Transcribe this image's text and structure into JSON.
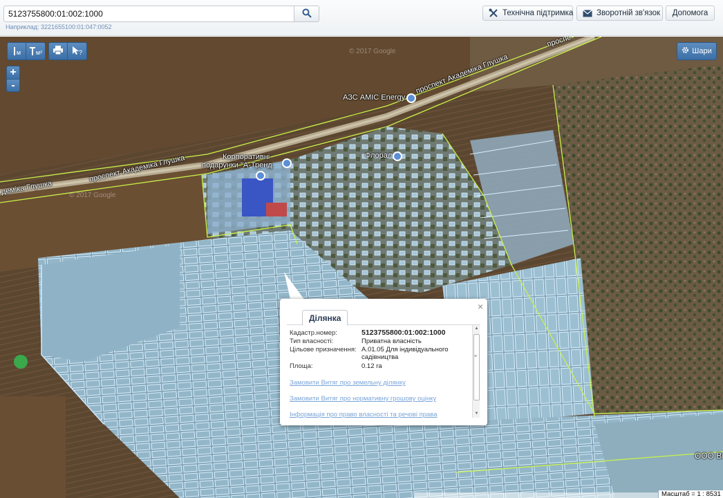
{
  "search": {
    "value": "5123755800:01:002:1000",
    "hint": "Наприклад: 3221655100:01:047:0052",
    "button_icon": "search-icon"
  },
  "header_buttons": [
    {
      "label": "Технічна підтримка",
      "icon": "tools-icon"
    },
    {
      "label": "Зворотній зв'язок",
      "icon": "envelope-icon"
    },
    {
      "label": "Допомога"
    }
  ],
  "map_tools": {
    "measure_length_label": "м",
    "measure_area_label": "м²",
    "zoom_in": "+",
    "zoom_out": "-",
    "layers_label": "Шари"
  },
  "map_labels": {
    "road_1": "проспект Академіка Глушка",
    "road_2": "проспект Академіка Глушка",
    "road_3": "проспект Академіка Глушка",
    "road_left": "деміка Глушка",
    "road_top_right": "проспе",
    "poi_aes": "АЗС AMIC Energy",
    "poi_flora": "Флорал",
    "poi_gifts_1": "Корпоративні",
    "poi_gifts_2": "подарунки \"А-Тренд",
    "poi_ooo": "ООО Ви",
    "watermark_1": "© 2017 Google",
    "watermark_2": "© 2017 Google"
  },
  "popup": {
    "close": "×",
    "tab": "Ділянка",
    "fields": [
      {
        "label": "Кадастр.номер:",
        "value": "5123755800:01:002:1000"
      },
      {
        "label": "Тип власності:",
        "value": "Приватна власність"
      },
      {
        "label": "Цільове призначення:",
        "value": "A.01.05 Для індивідуального садівництва"
      },
      {
        "label": "Площа:",
        "value": "0.12 га"
      }
    ],
    "links": [
      "Замовити Витяг про земельну ділянку",
      "Замовити Витяг про нормативну грошову оцінку",
      "Інформація про право власності та речові права"
    ]
  },
  "scale_label": "Масштаб = 1 : 8531",
  "colors": {
    "parcel_fill": "#9fd3f5",
    "parcel_stroke": "#c6ecff",
    "boundary": "#c8f24a",
    "tool_blue": "#4a7db3"
  }
}
